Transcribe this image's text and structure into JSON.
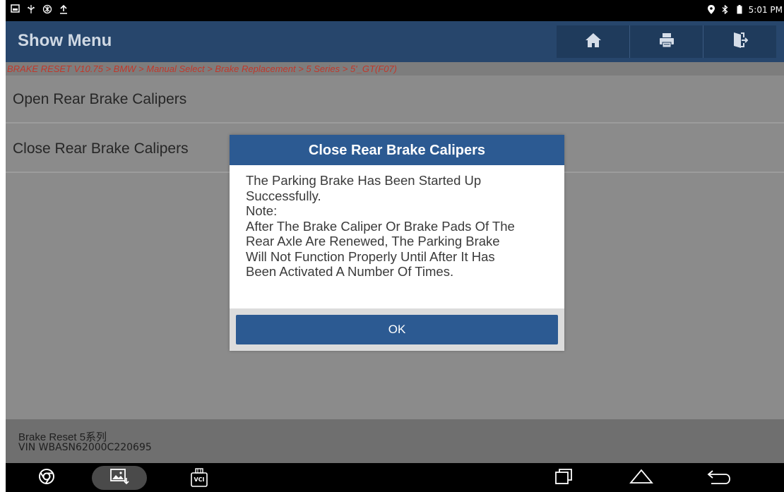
{
  "status_bar": {
    "left_icons": [
      "screenshot-icon",
      "usb-icon",
      "settings-icon",
      "upload-icon"
    ],
    "time": "5:01 PM",
    "right_icons": [
      "location-icon",
      "bluetooth-icon",
      "battery-icon"
    ]
  },
  "header": {
    "title": "Show Menu",
    "buttons": [
      "home-icon",
      "print-icon",
      "exit-icon"
    ]
  },
  "breadcrumb": "BRAKE RESET V10.75 > BMW > Manual Select > Brake Replacement > 5 Series > 5'_GT(F07)",
  "menu": {
    "items": [
      {
        "label": "Open Rear Brake Calipers"
      },
      {
        "label": "Close Rear Brake Calipers"
      }
    ]
  },
  "dialog": {
    "title": "Close Rear Brake Calipers",
    "lines": [
      "The Parking Brake Has Been Started Up",
      "Successfully.",
      "Note:",
      "After The Brake Caliper Or Brake Pads Of The",
      "Rear Axle Are Renewed, The Parking Brake",
      "Will Not Function Properly Until After It Has",
      "Been Activated A Number Of Times."
    ],
    "ok_label": "OK"
  },
  "footer": {
    "line1": "Brake Reset 5系列",
    "line2": "VIN WBASN62000C220695"
  },
  "nav_bar": {
    "vci_label": "VCI",
    "icons": [
      "browser-icon",
      "gallery-icon",
      "vci-icon",
      "recent-apps-icon",
      "home-nav-icon",
      "back-icon"
    ]
  },
  "colors": {
    "header_bg": "#27466c",
    "dialog_title_bg": "#2c5a92",
    "breadcrumb_text": "#c0382b",
    "overlay_bg": "#8b8b8b"
  }
}
